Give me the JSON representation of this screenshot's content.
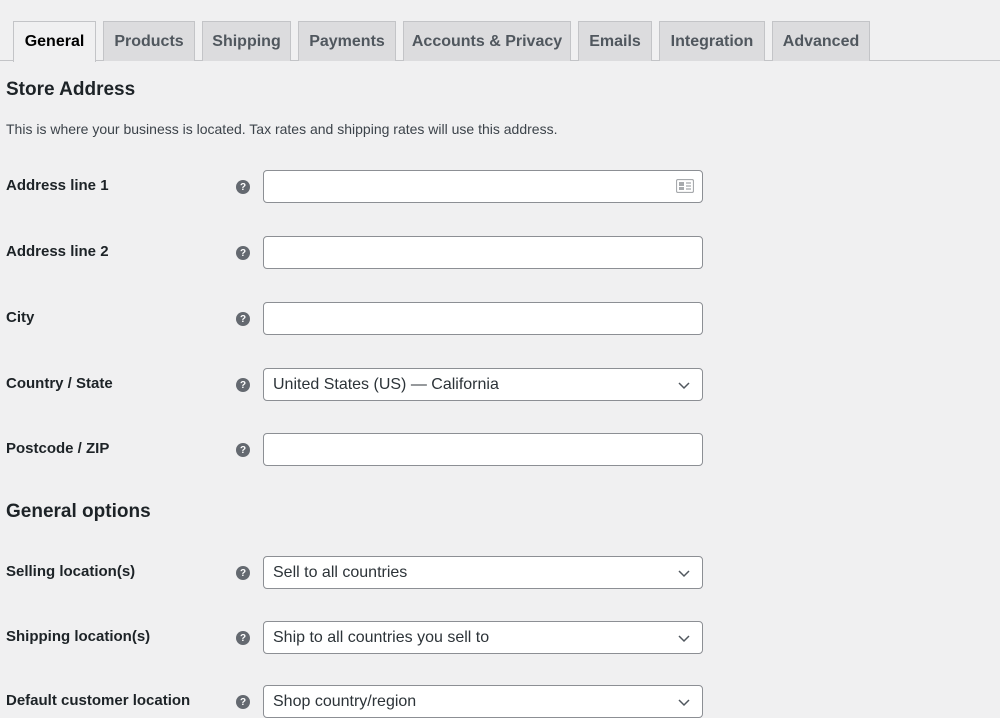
{
  "tabs": [
    {
      "label": "General",
      "active": true
    },
    {
      "label": "Products",
      "active": false
    },
    {
      "label": "Shipping",
      "active": false
    },
    {
      "label": "Payments",
      "active": false
    },
    {
      "label": "Accounts & Privacy",
      "active": false
    },
    {
      "label": "Emails",
      "active": false
    },
    {
      "label": "Integration",
      "active": false
    },
    {
      "label": "Advanced",
      "active": false
    }
  ],
  "store_address": {
    "title": "Store Address",
    "description": "This is where your business is located. Tax rates and shipping rates will use this address.",
    "fields": [
      {
        "label": "Address line 1",
        "type": "text",
        "value": ""
      },
      {
        "label": "Address line 2",
        "type": "text",
        "value": ""
      },
      {
        "label": "City",
        "type": "text",
        "value": ""
      },
      {
        "label": "Country / State",
        "type": "select",
        "value": "United States (US) — California"
      },
      {
        "label": "Postcode / ZIP",
        "type": "text",
        "value": ""
      }
    ]
  },
  "general_options": {
    "title": "General options",
    "fields": [
      {
        "label": "Selling location(s)",
        "type": "select",
        "value": "Sell to all countries"
      },
      {
        "label": "Shipping location(s)",
        "type": "select",
        "value": "Ship to all countries you sell to"
      },
      {
        "label": "Default customer location",
        "type": "select",
        "value": "Shop country/region"
      }
    ]
  },
  "help_icon_glyph": "?"
}
